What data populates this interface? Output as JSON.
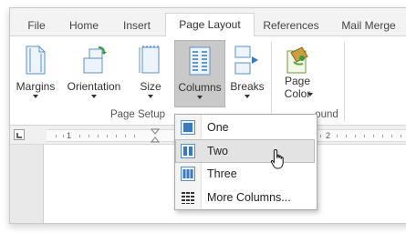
{
  "tabs": [
    {
      "label": "File"
    },
    {
      "label": "Home"
    },
    {
      "label": "Insert"
    },
    {
      "label": "Page Layout",
      "active": true
    },
    {
      "label": "References"
    },
    {
      "label": "Mail Merge"
    }
  ],
  "ribbon": {
    "margins": "Margins",
    "orientation": "Orientation",
    "size": "Size",
    "columns": "Columns",
    "breaks": "Breaks",
    "page_color_line1": "Page",
    "page_color_line2": "Color",
    "group_page_setup": "Page Setup",
    "group_background_partial": "ound"
  },
  "ruler": {
    "mark1": "1",
    "mark2": "2"
  },
  "columns_menu": {
    "items": [
      {
        "label": "One",
        "icon": "one-column-icon"
      },
      {
        "label": "Two",
        "icon": "two-columns-icon",
        "hovered": true
      },
      {
        "label": "Three",
        "icon": "three-columns-icon"
      },
      {
        "label": "More Columns...",
        "icon": "more-columns-icon"
      }
    ]
  },
  "colors": {
    "accent_blue": "#3a78c2",
    "pressed_gray": "#c9c9c9",
    "hover_gray": "#e3e3e3"
  }
}
